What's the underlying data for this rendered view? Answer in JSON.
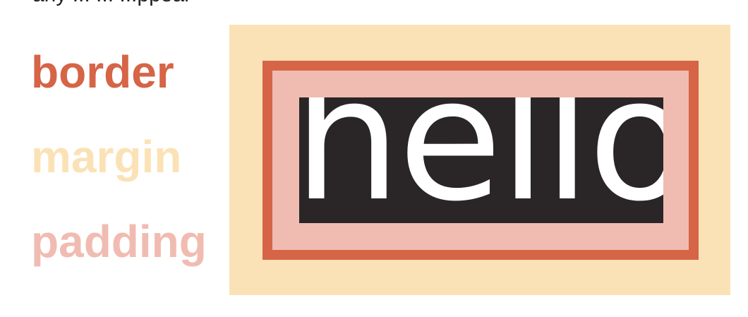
{
  "top_text": "any       ...   ...   ...ppear",
  "legend": {
    "border": "border",
    "margin": "margin",
    "padding": "padding"
  },
  "content": {
    "text": "hello"
  },
  "colors": {
    "border": "#d66446",
    "margin": "#fbe2b6",
    "padding": "#f0bcb2",
    "content_bg": "#2a2627",
    "content_text": "#ffffff"
  }
}
